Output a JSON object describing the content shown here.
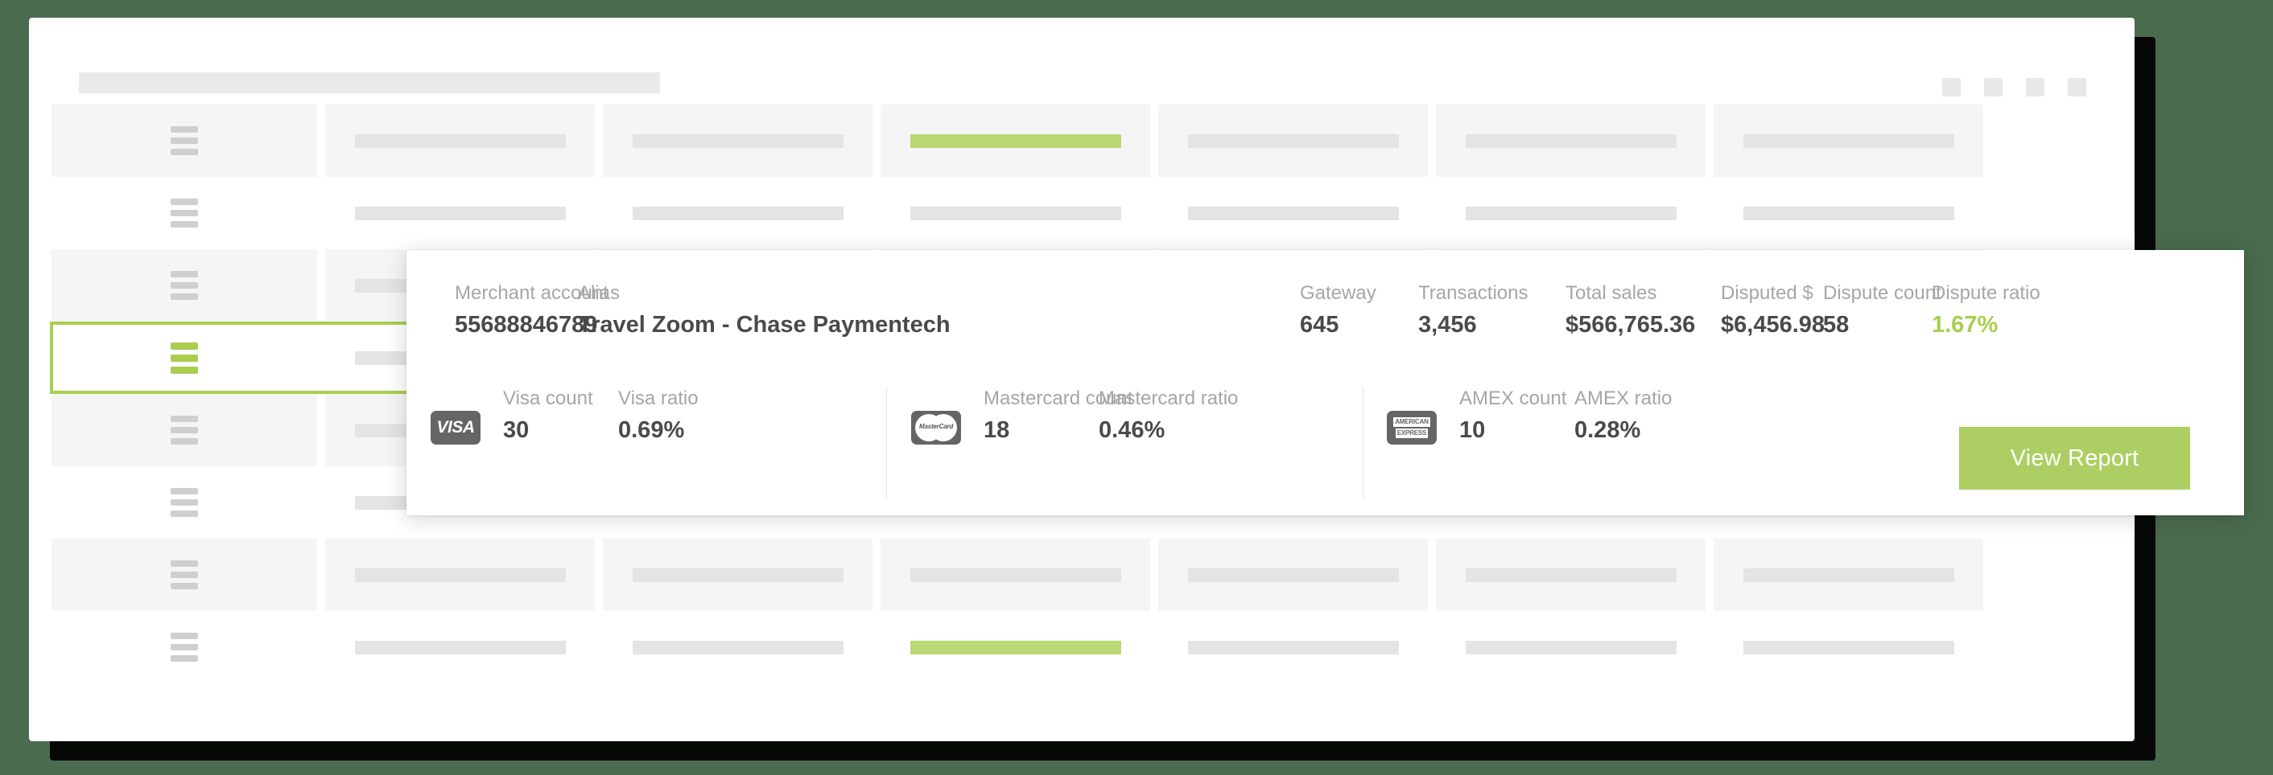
{
  "window": {
    "dots": [
      "window-dot-1",
      "window-dot-2",
      "window-dot-3",
      "window-dot-4"
    ]
  },
  "detail_panel": {
    "stats": [
      {
        "key": "merchant_account",
        "label": "Merchant account",
        "value": "55688846789",
        "accent": false
      },
      {
        "key": "alias",
        "label": "Alias",
        "value": "Travel Zoom - Chase Paymentech",
        "accent": false
      },
      {
        "key": "gateway",
        "label": "Gateway",
        "value": "645",
        "accent": false
      },
      {
        "key": "transactions",
        "label": "Transactions",
        "value": "3,456",
        "accent": false
      },
      {
        "key": "total_sales",
        "label": "Total sales",
        "value": "$566,765.36",
        "accent": false
      },
      {
        "key": "disputed_amount",
        "label": "Disputed $",
        "value": "$6,456.98",
        "accent": false
      },
      {
        "key": "dispute_count",
        "label": "Dispute count",
        "value": "58",
        "accent": false
      },
      {
        "key": "dispute_ratio",
        "label": "Dispute ratio",
        "value": "1.67%",
        "accent": true
      }
    ],
    "brands": [
      {
        "key": "visa",
        "logo": "visa-logo-icon",
        "logo_text": "VISA",
        "count_label": "Visa count",
        "count_value": "30",
        "ratio_label": "Visa ratio",
        "ratio_value": "0.69%"
      },
      {
        "key": "mastercard",
        "logo": "mastercard-logo-icon",
        "logo_text": "MasterCard",
        "count_label": "Mastercard count",
        "count_value": "18",
        "ratio_label": "Mastercard ratio",
        "ratio_value": "0.46%"
      },
      {
        "key": "amex",
        "logo": "amex-logo-icon",
        "logo_text_line1": "AMERICAN",
        "logo_text_line2": "EXPRESS",
        "count_label": "AMEX count",
        "count_value": "10",
        "ratio_label": "AMEX ratio",
        "ratio_value": "0.28%"
      }
    ],
    "view_report_label": "View Report"
  },
  "colors": {
    "accent_green": "#a8ce4f",
    "button_green": "#adce62",
    "bar_green": "#bad873",
    "bar_red": "#e68e8b",
    "skeleton_bar": "#e4e4e4",
    "row_shaded": "#f5f5f5",
    "page_background": "#4a6b4e",
    "label_gray": "#a6a6a6",
    "value_gray": "#4a4a4a"
  },
  "skeleton_table": {
    "menu_icon": "hamburger-menu-icon",
    "rows": [
      {
        "index": 0,
        "shaded": true,
        "selected": false,
        "menu": "gray",
        "cells": [
          "menu",
          "bar",
          "bar",
          "bar-green",
          "bar",
          "bar",
          "bar"
        ]
      },
      {
        "index": 1,
        "shaded": false,
        "selected": false,
        "menu": "gray",
        "cells": [
          "menu",
          "bar",
          "bar",
          "bar",
          "bar",
          "bar",
          "bar"
        ]
      },
      {
        "index": 2,
        "shaded": true,
        "selected": false,
        "menu": "gray",
        "cells": [
          "menu",
          "bar",
          "bar",
          "bar",
          "bar",
          "bar",
          "bar"
        ]
      },
      {
        "index": 3,
        "shaded": false,
        "selected": true,
        "menu": "green",
        "cells": [
          "menu",
          "bar",
          "bar",
          "bar",
          "bar",
          "bar",
          "bar"
        ]
      },
      {
        "index": 4,
        "shaded": true,
        "selected": false,
        "menu": "gray",
        "cells": [
          "menu",
          "bar",
          "bar",
          "bar",
          "bar",
          "bar",
          "bar"
        ]
      },
      {
        "index": 5,
        "shaded": false,
        "selected": false,
        "menu": "gray",
        "cells": [
          "menu",
          "bar",
          "bar",
          "bar-red",
          "bar",
          "bar",
          "bar"
        ]
      },
      {
        "index": 6,
        "shaded": true,
        "selected": false,
        "menu": "gray",
        "cells": [
          "menu",
          "bar",
          "bar",
          "bar",
          "bar",
          "bar",
          "bar"
        ]
      },
      {
        "index": 7,
        "shaded": false,
        "selected": false,
        "menu": "gray",
        "cells": [
          "menu",
          "bar",
          "bar",
          "bar-green",
          "bar",
          "bar",
          "bar"
        ]
      }
    ]
  }
}
